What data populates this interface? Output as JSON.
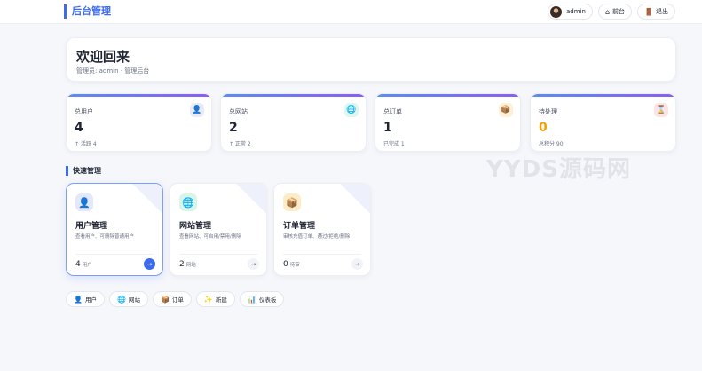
{
  "header": {
    "brand": "后台管理",
    "user": "admin",
    "front_label": "前台",
    "logout_label": "退出"
  },
  "welcome": {
    "title": "欢迎回来",
    "subtitle": "管理员: admin · 管理后台"
  },
  "stats": [
    {
      "label": "总用户",
      "value": "4",
      "note": "↑ 活跃 4",
      "icon": "user-icon",
      "icon_glyph": "👤",
      "icon_bg": "#e8ebf7"
    },
    {
      "label": "总网站",
      "value": "2",
      "note": "↑ 正常 2",
      "icon": "globe-icon",
      "icon_glyph": "🌐",
      "icon_bg": "#dff6ec"
    },
    {
      "label": "总订单",
      "value": "1",
      "note": "已完成 1",
      "icon": "box-icon",
      "icon_glyph": "📦",
      "icon_bg": "#fdf0d6"
    },
    {
      "label": "待处理",
      "value": "0",
      "note": "总积分 90",
      "icon": "hourglass-icon",
      "icon_glyph": "⌛",
      "icon_bg": "#fde4e4"
    }
  ],
  "section_title": "快速管理",
  "modules": [
    {
      "title": "用户管理",
      "desc": "查看用户、可删除普通用户",
      "count": "4",
      "unit": "用户",
      "icon": "user-icon",
      "icon_glyph": "👤",
      "icon_bg": "#e3e8fb"
    },
    {
      "title": "网站管理",
      "desc": "查看网站、可启用/禁用/删除",
      "count": "2",
      "unit": "网站",
      "icon": "globe-icon",
      "icon_glyph": "🌐",
      "icon_bg": "#d9f4e8"
    },
    {
      "title": "订单管理",
      "desc": "审核充值订单、通过/拒绝/删除",
      "count": "0",
      "unit": "待审",
      "icon": "box-icon",
      "icon_glyph": "📦",
      "icon_bg": "#fdecc8"
    }
  ],
  "go_glyph": "→",
  "quick_links": [
    {
      "label": "用户",
      "icon": "user-icon",
      "icon_glyph": "👤"
    },
    {
      "label": "网站",
      "icon": "globe-icon",
      "icon_glyph": "🌐"
    },
    {
      "label": "订单",
      "icon": "box-icon",
      "icon_glyph": "📦"
    },
    {
      "label": "新建",
      "icon": "sparkle-icon",
      "icon_glyph": "✨"
    },
    {
      "label": "仪表板",
      "icon": "chart-icon",
      "icon_glyph": "📊"
    }
  ],
  "header_icons": {
    "front": "home-icon",
    "front_glyph": "⌂",
    "logout": "door-icon",
    "logout_glyph": "🚪"
  },
  "watermark": "YYDS源码网",
  "colors": {
    "accent": "#3b6cf0",
    "pending": "#f59e0b"
  }
}
